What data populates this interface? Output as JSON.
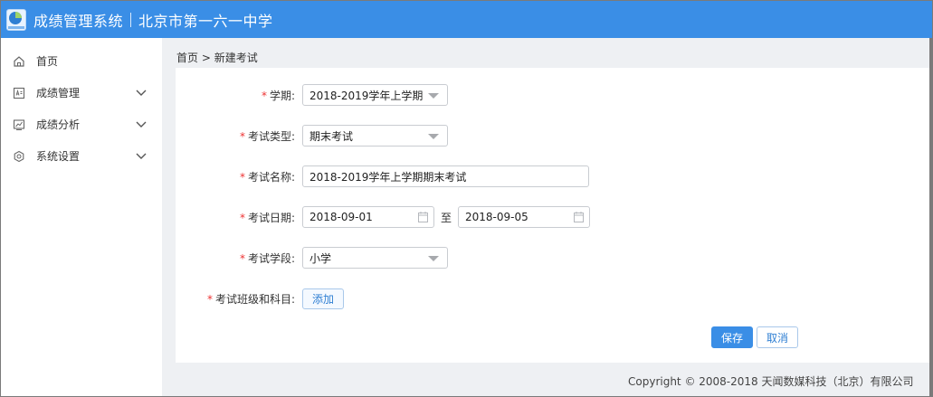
{
  "header": {
    "app_title": "成绩管理系统",
    "school_name": "北京市第一六一中学",
    "bg_color": "#3a8ee6"
  },
  "sidebar": {
    "items": [
      {
        "label": "首页",
        "icon": "home-icon",
        "expandable": false
      },
      {
        "label": "成绩管理",
        "icon": "grade-doc-icon",
        "expandable": true
      },
      {
        "label": "成绩分析",
        "icon": "chart-icon",
        "expandable": true
      },
      {
        "label": "系统设置",
        "icon": "gear-icon",
        "expandable": true
      }
    ]
  },
  "breadcrumb": {
    "home": "首页",
    "separator": ">",
    "current": "新建考试"
  },
  "form": {
    "semester": {
      "label": "学期:",
      "value": "2018-2019学年上学期"
    },
    "exam_type": {
      "label": "考试类型:",
      "value": "期末考试"
    },
    "exam_name": {
      "label": "考试名称:",
      "value": "2018-2019学年上学期期末考试"
    },
    "exam_date": {
      "label": "考试日期:",
      "start": "2018-09-01",
      "to": "至",
      "end": "2018-09-05"
    },
    "exam_level": {
      "label": "考试学段:",
      "value": "小学"
    },
    "class_subject": {
      "label": "考试班级和科目:",
      "add_label": "添加"
    },
    "required_mark": "*"
  },
  "actions": {
    "save_label": "保存",
    "cancel_label": "取消",
    "primary_color": "#3a8ee6"
  },
  "footer": {
    "copyright": "Copyright © 2008-2018 天闻数媒科技（北京）有限公司"
  }
}
